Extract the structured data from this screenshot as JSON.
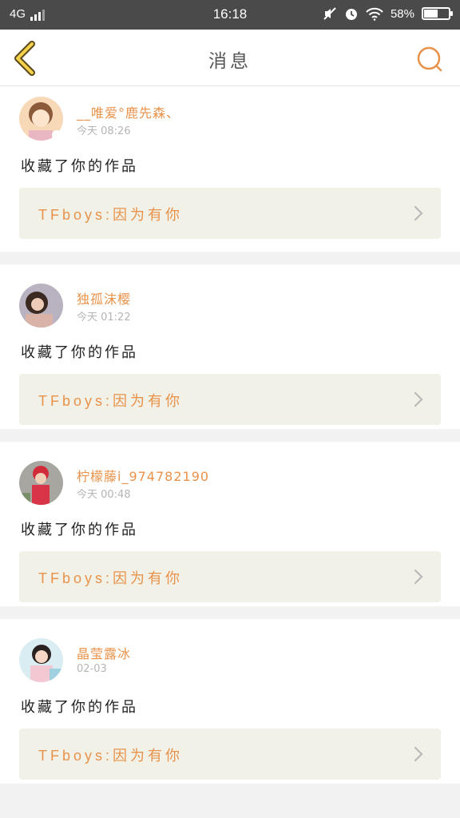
{
  "status_bar": {
    "network": "4G",
    "time": "16:18",
    "battery_text": "58%",
    "battery_level": 0.58,
    "icons": [
      "signal-icon",
      "mute-icon",
      "alarm-icon",
      "wifi-icon",
      "battery-icon"
    ]
  },
  "header": {
    "title": "消息",
    "back_icon": "chevron-left-icon",
    "search_icon": "search-icon"
  },
  "colors": {
    "accent": "#e8924a",
    "back_icon_fill": "#f5d14a",
    "card_bg": "#f1f1e8"
  },
  "messages": [
    {
      "user": "__唯爱°鹿先森、",
      "time": "今天 08:26",
      "action": "收藏了你的作品",
      "work_prefix": "TFboys:",
      "work_title": "因为有你"
    },
    {
      "user": "独孤沫樱",
      "time": "今天 01:22",
      "action": "收藏了你的作品",
      "work_prefix": "TFboys:",
      "work_title": "因为有你"
    },
    {
      "user": "柠檬藤i_974782190",
      "time": "今天 00:48",
      "action": "收藏了你的作品",
      "work_prefix": "TFboys:",
      "work_title": "因为有你"
    },
    {
      "user": "晶莹露冰",
      "time": "02-03",
      "action": "收藏了你的作品",
      "work_prefix": "TFboys:",
      "work_title": "因为有你"
    }
  ]
}
